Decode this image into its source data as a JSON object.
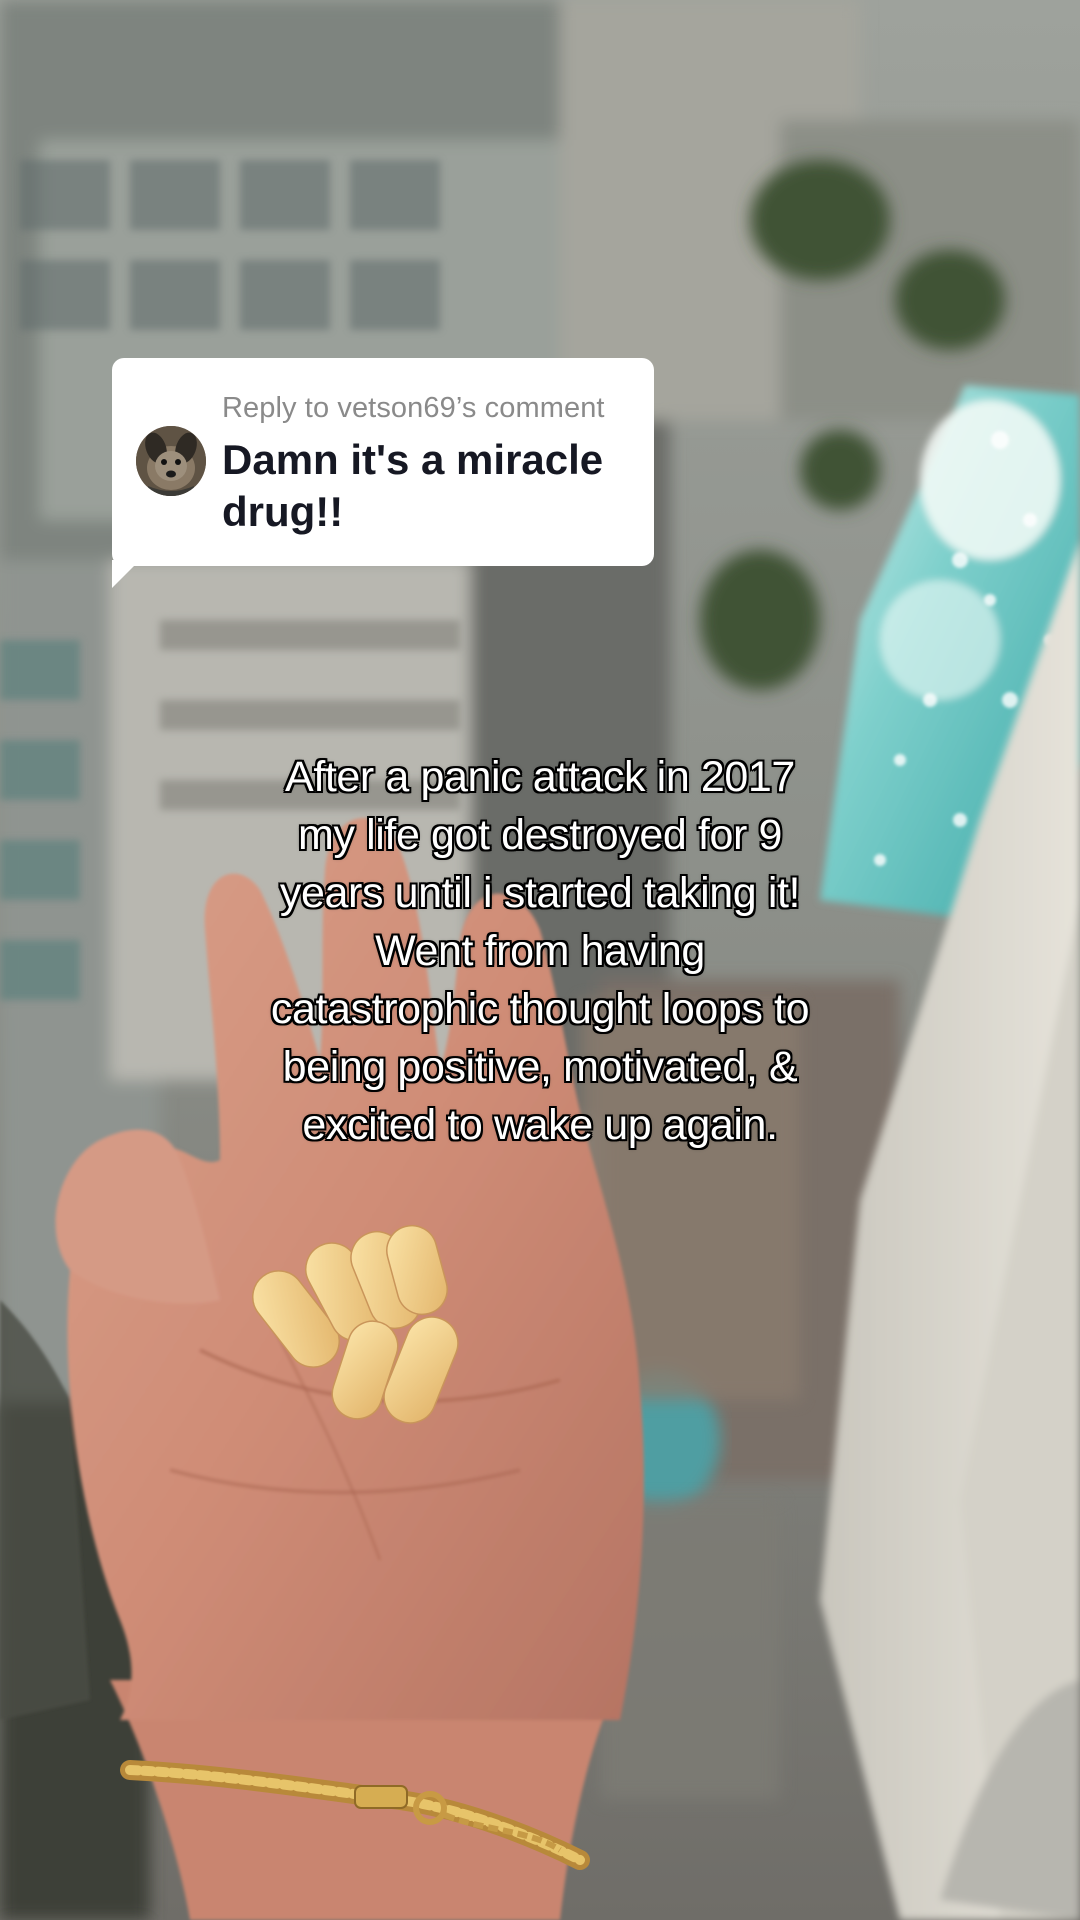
{
  "reply": {
    "label": "Reply to vetson69’s comment",
    "comment": "Damn it's a miracle drug!!",
    "avatar_icon": "dog-avatar-icon"
  },
  "caption": {
    "lines": [
      "After a panic attack in 2017",
      "my life got destroyed for 9",
      "years until i started taking it!",
      "Went from having",
      "catastrophic thought loops to",
      "being positive, motivated, &",
      "excited to wake up again."
    ]
  },
  "colors": {
    "bubble_bg": "#ffffff",
    "label_gray": "#8a8a8a",
    "comment_text": "#161823",
    "caption_text": "#ffffff",
    "caption_outline": "#000000"
  }
}
